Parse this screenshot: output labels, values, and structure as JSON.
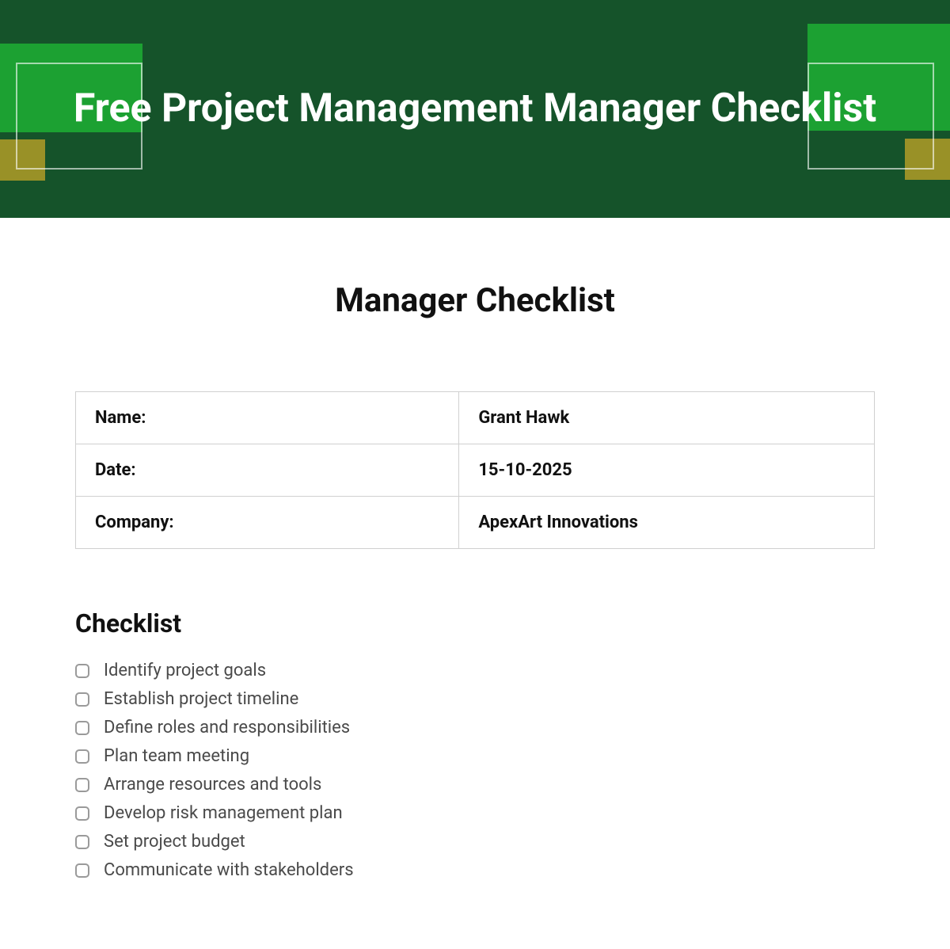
{
  "header": {
    "title": "Free Project Management Manager Checklist"
  },
  "page": {
    "title": "Manager Checklist"
  },
  "info": {
    "fields": [
      {
        "label": "Name:",
        "value": "Grant Hawk"
      },
      {
        "label": "Date:",
        "value": "15-10-2025"
      },
      {
        "label": "Company:",
        "value": "ApexArt Innovations"
      }
    ]
  },
  "checklist": {
    "title": "Checklist",
    "items": [
      {
        "text": "Identify project goals",
        "checked": false
      },
      {
        "text": "Establish project timeline",
        "checked": false
      },
      {
        "text": "Define roles and responsibilities",
        "checked": false
      },
      {
        "text": "Plan team meeting",
        "checked": false
      },
      {
        "text": "Arrange resources and tools",
        "checked": false
      },
      {
        "text": "Develop risk management plan",
        "checked": false
      },
      {
        "text": "Set project budget",
        "checked": false
      },
      {
        "text": "Communicate with stakeholders",
        "checked": false
      }
    ]
  }
}
